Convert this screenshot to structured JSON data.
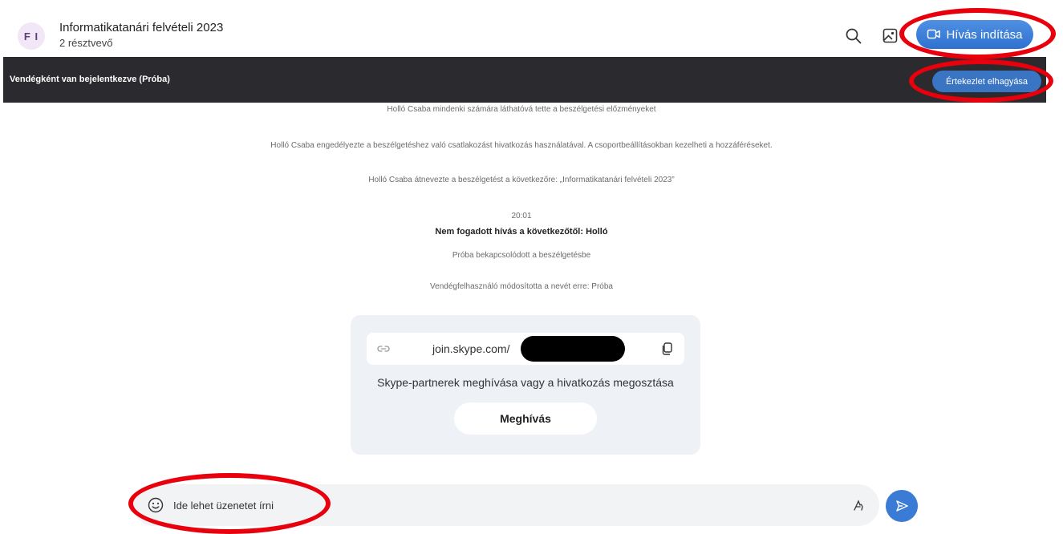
{
  "header": {
    "avatar_initials": "F I",
    "title": "Informatikatanári felvételi 2023",
    "subtitle": "2 résztvevő",
    "call_button_label": "Hívás indítása",
    "icons": [
      "search-icon",
      "gallery-icon",
      "video-call-icon"
    ]
  },
  "guest_bar": {
    "text": "Vendégként van bejelentkezve (Próba)",
    "leave_button_label": "Értekezlet elhagyása"
  },
  "messages": [
    "Holló Csaba mindenki számára láthatóvá tette a beszélgetési előzményeket",
    "Holló Csaba engedélyezte a beszélgetéshez való csatlakozást hivatkozás használatával. A csoportbeállításokban kezelheti a hozzáféréseket.",
    "Holló Csaba átnevezte a beszélgetést a következőre: „Informatikatanári felvételi 2023”",
    "20:01",
    "Nem fogadott hívás a következőtől: Holló",
    "Próba bekapcsolódott a beszélgetésbe",
    "Vendégfelhasználó módosította a nevét erre: Próba"
  ],
  "invite_card": {
    "link_text": "join.skype.com/",
    "description": "Skype-partnerek meghívása vagy a hivatkozás megosztása",
    "invite_button_label": "Meghívás"
  },
  "composer": {
    "placeholder": "Ide lehet üzenetet írni",
    "value": ""
  },
  "colors": {
    "accent": "#3a7bd5",
    "guest_bar": "#2b2b2f",
    "highlight_ring": "#e8000c"
  }
}
